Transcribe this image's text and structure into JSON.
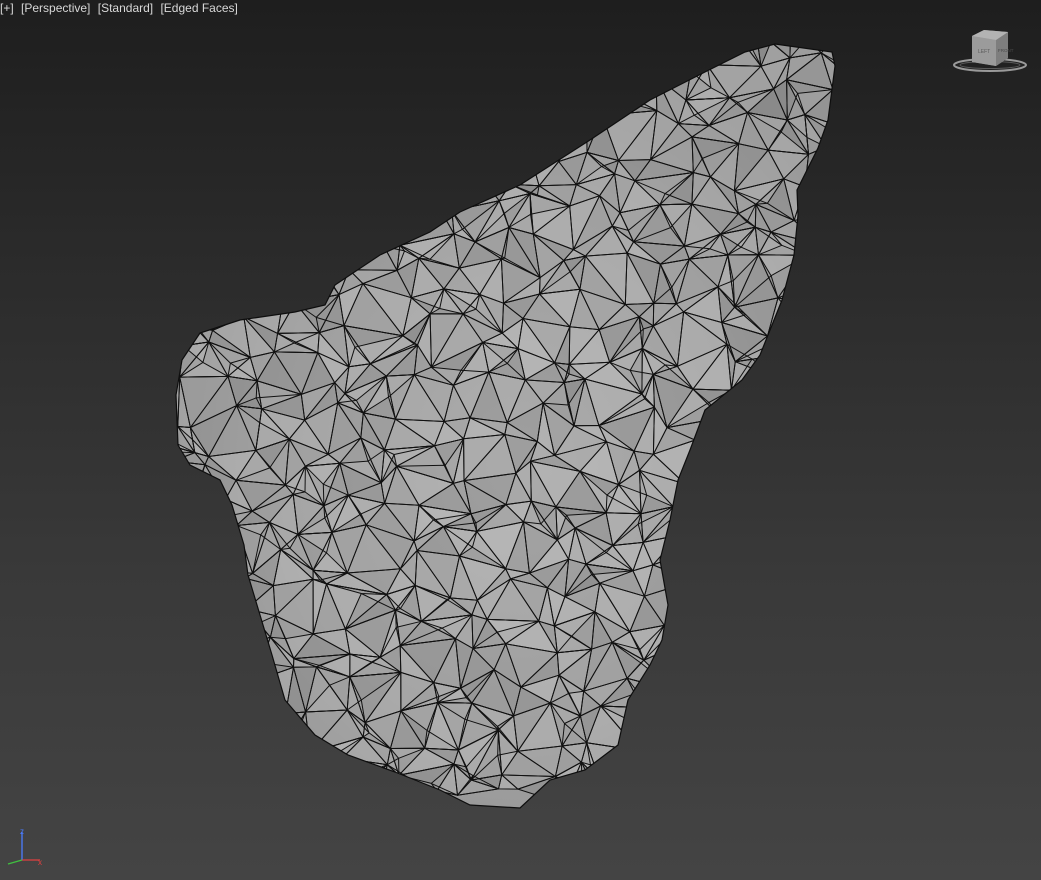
{
  "viewport": {
    "labels": {
      "menu": "[+]",
      "view": "[Perspective]",
      "shading_mode": "[Standard]",
      "display_mode": "[Edged Faces]"
    },
    "viewcube": {
      "icon": "viewcube-icon",
      "face_labels": [
        "LEFT",
        "FRONT"
      ]
    },
    "axis_tripod": {
      "axes": [
        "z",
        "x"
      ],
      "colors": {
        "z": "#4a7cff",
        "x": "#e04040",
        "y": "#40c040"
      }
    },
    "mesh": {
      "icon": "rock-mesh",
      "surface_color": "#a9a9a9",
      "edge_color": "#101010"
    }
  }
}
